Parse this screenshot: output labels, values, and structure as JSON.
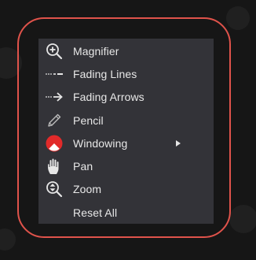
{
  "menu": {
    "items": [
      {
        "label": "Magnifier",
        "icon": "magnifier-icon"
      },
      {
        "label": "Fading Lines",
        "icon": "fading-lines-icon"
      },
      {
        "label": "Fading Arrows",
        "icon": "fading-arrows-icon"
      },
      {
        "label": "Pencil",
        "icon": "pencil-icon"
      },
      {
        "label": "Windowing",
        "icon": "windowing-icon",
        "has_submenu": true
      },
      {
        "label": "Pan",
        "icon": "hand-icon"
      },
      {
        "label": "Zoom",
        "icon": "zoom-icon"
      },
      {
        "label": "Reset All",
        "icon": null
      }
    ]
  },
  "colors": {
    "menu_background": "#333338",
    "menu_text": "#e8e8e8",
    "icon_color": "#e6e6e6",
    "windowing_red": "#e22a2a",
    "highlight_frame": "#e0534b",
    "page_background": "#161616"
  }
}
